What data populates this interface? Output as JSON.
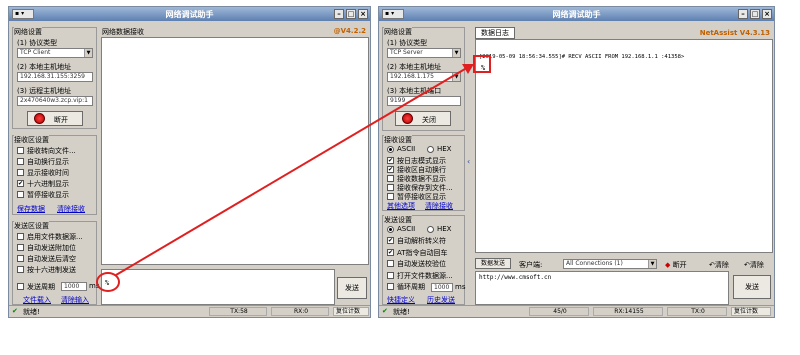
{
  "left": {
    "title": "网络调试助手",
    "version": "@V4.2.2",
    "net_settings": {
      "title": "网络设置",
      "protocol_label": "(1) 协议类型",
      "protocol_value": "TCP Client",
      "host_label": "(2) 本地主机地址",
      "host_value": "192.168.31.155:3259",
      "remote_label": "(3) 远程主机地址",
      "remote_value": "2x470640w3.zcp.vip:1",
      "connect_button": "断开"
    },
    "recv_settings": {
      "title": "接收区设置",
      "options": [
        {
          "label": "接收转向文件...",
          "checked": false
        },
        {
          "label": "自动换行显示",
          "checked": false
        },
        {
          "label": "显示接收时间",
          "checked": false
        },
        {
          "label": "十六进制显示",
          "checked": true
        },
        {
          "label": "暂停接收显示",
          "checked": false
        }
      ],
      "link_save": "保存数据",
      "link_clear": "清除接收"
    },
    "send_settings": {
      "title": "发送区设置",
      "options": [
        {
          "label": "启用文件数据源...",
          "checked": false
        },
        {
          "label": "自动发送附加位",
          "checked": false
        },
        {
          "label": "自动发送后清空",
          "checked": false
        },
        {
          "label": "按十六进制发送",
          "checked": false
        }
      ],
      "period_label": "发送周期",
      "period_value": "1000",
      "period_unit": "ms",
      "link_load": "文件载入",
      "link_clear": "清除输入"
    },
    "recv_area_label": "网络数据接收",
    "send_text": "%",
    "send_button": "发送",
    "status": {
      "ready": "就绪!",
      "tx": "TX:58",
      "rx": "RX:0",
      "reset": "复位计数"
    }
  },
  "right": {
    "title": "网络调试助手",
    "brand": "NetAssist V4.3.13",
    "net_settings": {
      "title": "网络设置",
      "protocol_label": "(1) 协议类型",
      "protocol_value": "TCP Server",
      "host_label": "(2) 本地主机地址",
      "host_value": "192.168.1.175",
      "port_label": "(3) 本地主机端口",
      "port_value": "9199",
      "close_button": "关闭"
    },
    "recv_settings": {
      "title": "接收设置",
      "radio_ascii": "ASCII",
      "radio_hex": "HEX",
      "options": [
        {
          "label": "按日志模式显示",
          "checked": true
        },
        {
          "label": "接收区自动换行",
          "checked": true
        },
        {
          "label": "接收数据不显示",
          "checked": false
        },
        {
          "label": "接收保存到文件...",
          "checked": false
        },
        {
          "label": "暂停接收区显示",
          "checked": false
        }
      ],
      "link_more": "其他选项",
      "link_clear": "清除接收"
    },
    "send_settings": {
      "title": "发送设置",
      "radio_ascii": "ASCII",
      "radio_hex": "HEX",
      "options": [
        {
          "label": "自动解析转义符",
          "checked": true
        },
        {
          "label": "AT指令自动回车",
          "checked": true
        },
        {
          "label": "自动发送校验位",
          "checked": false
        },
        {
          "label": "打开文件数据源...",
          "checked": false
        },
        {
          "label": "循环周期",
          "checked": false
        }
      ],
      "period_value": "1000",
      "period_unit": "ms",
      "link_shortcut": "快捷定义",
      "link_history": "历史发送"
    },
    "log_tab": "数据日志",
    "log_line": "[2019-05-09 18:56:34.555]# RECV ASCII FROM 192.168.1.1 :41358>",
    "log_data": "%",
    "send_bar": {
      "tab": "数据发送",
      "client_label": "客户端:",
      "client_value": "All Connections (1)",
      "disconnect": "断开",
      "clear": "清除",
      "clear2": "清除"
    },
    "send_text": "http://www.cmsoft.cn",
    "send_button": "发送",
    "status": {
      "ready": "就绪!",
      "count": "45/0",
      "rx": "RX:14155",
      "tx": "TX:0",
      "reset": "复位计数"
    }
  }
}
